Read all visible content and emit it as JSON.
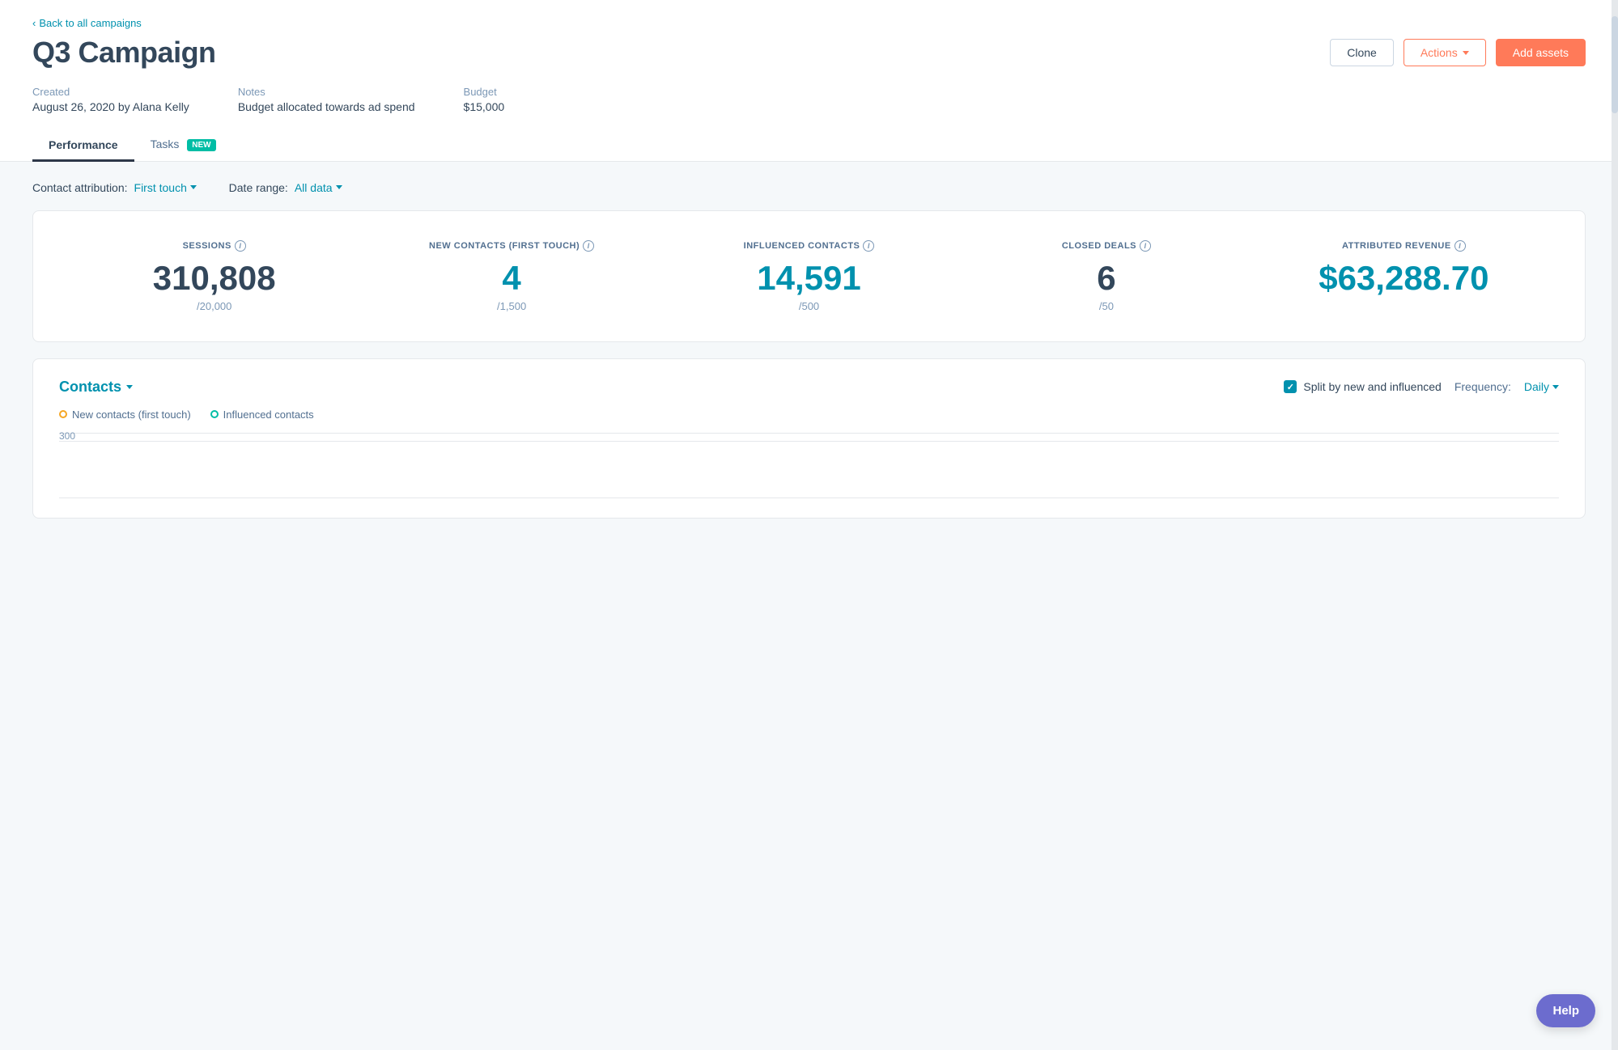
{
  "back_link": "Back to all campaigns",
  "campaign_title": "Q3 Campaign",
  "buttons": {
    "clone": "Clone",
    "actions": "Actions",
    "add_assets": "Add assets"
  },
  "meta": {
    "created_label": "Created",
    "created_value": "August 26, 2020 by Alana Kelly",
    "notes_label": "Notes",
    "notes_value": "Budget allocated towards ad spend",
    "budget_label": "Budget",
    "budget_value": "$15,000"
  },
  "tabs": [
    {
      "id": "performance",
      "label": "Performance",
      "active": true
    },
    {
      "id": "tasks",
      "label": "Tasks",
      "badge": "NEW"
    }
  ],
  "filters": {
    "attribution_label": "Contact attribution:",
    "attribution_value": "First touch",
    "date_label": "Date range:",
    "date_value": "All data"
  },
  "stats": [
    {
      "id": "sessions",
      "label": "SESSIONS",
      "value": "310,808",
      "sub": "/20,000",
      "teal": false,
      "info": true
    },
    {
      "id": "new-contacts",
      "label": "NEW CONTACTS (FIRST TOUCH)",
      "value": "4",
      "sub": "/1,500",
      "teal": true,
      "info": true
    },
    {
      "id": "influenced-contacts",
      "label": "INFLUENCED CONTACTS",
      "value": "14,591",
      "sub": "/500",
      "teal": true,
      "info": true
    },
    {
      "id": "closed-deals",
      "label": "CLOSED DEALS",
      "value": "6",
      "sub": "/50",
      "teal": false,
      "info": true
    },
    {
      "id": "attributed-revenue",
      "label": "ATTRIBUTED REVENUE",
      "value": "$63,288.70",
      "sub": "",
      "teal": false,
      "info": true
    }
  ],
  "contacts_section": {
    "title": "Contacts",
    "split_label": "Split by new and influenced",
    "frequency_label": "Frequency:",
    "frequency_value": "Daily",
    "legend": [
      {
        "id": "new-contacts-first-touch",
        "label": "New contacts (first touch)",
        "color": "orange"
      },
      {
        "id": "influenced-contacts",
        "label": "Influenced contacts",
        "color": "teal"
      }
    ],
    "chart_y_label": "300"
  },
  "help_button": "Help"
}
